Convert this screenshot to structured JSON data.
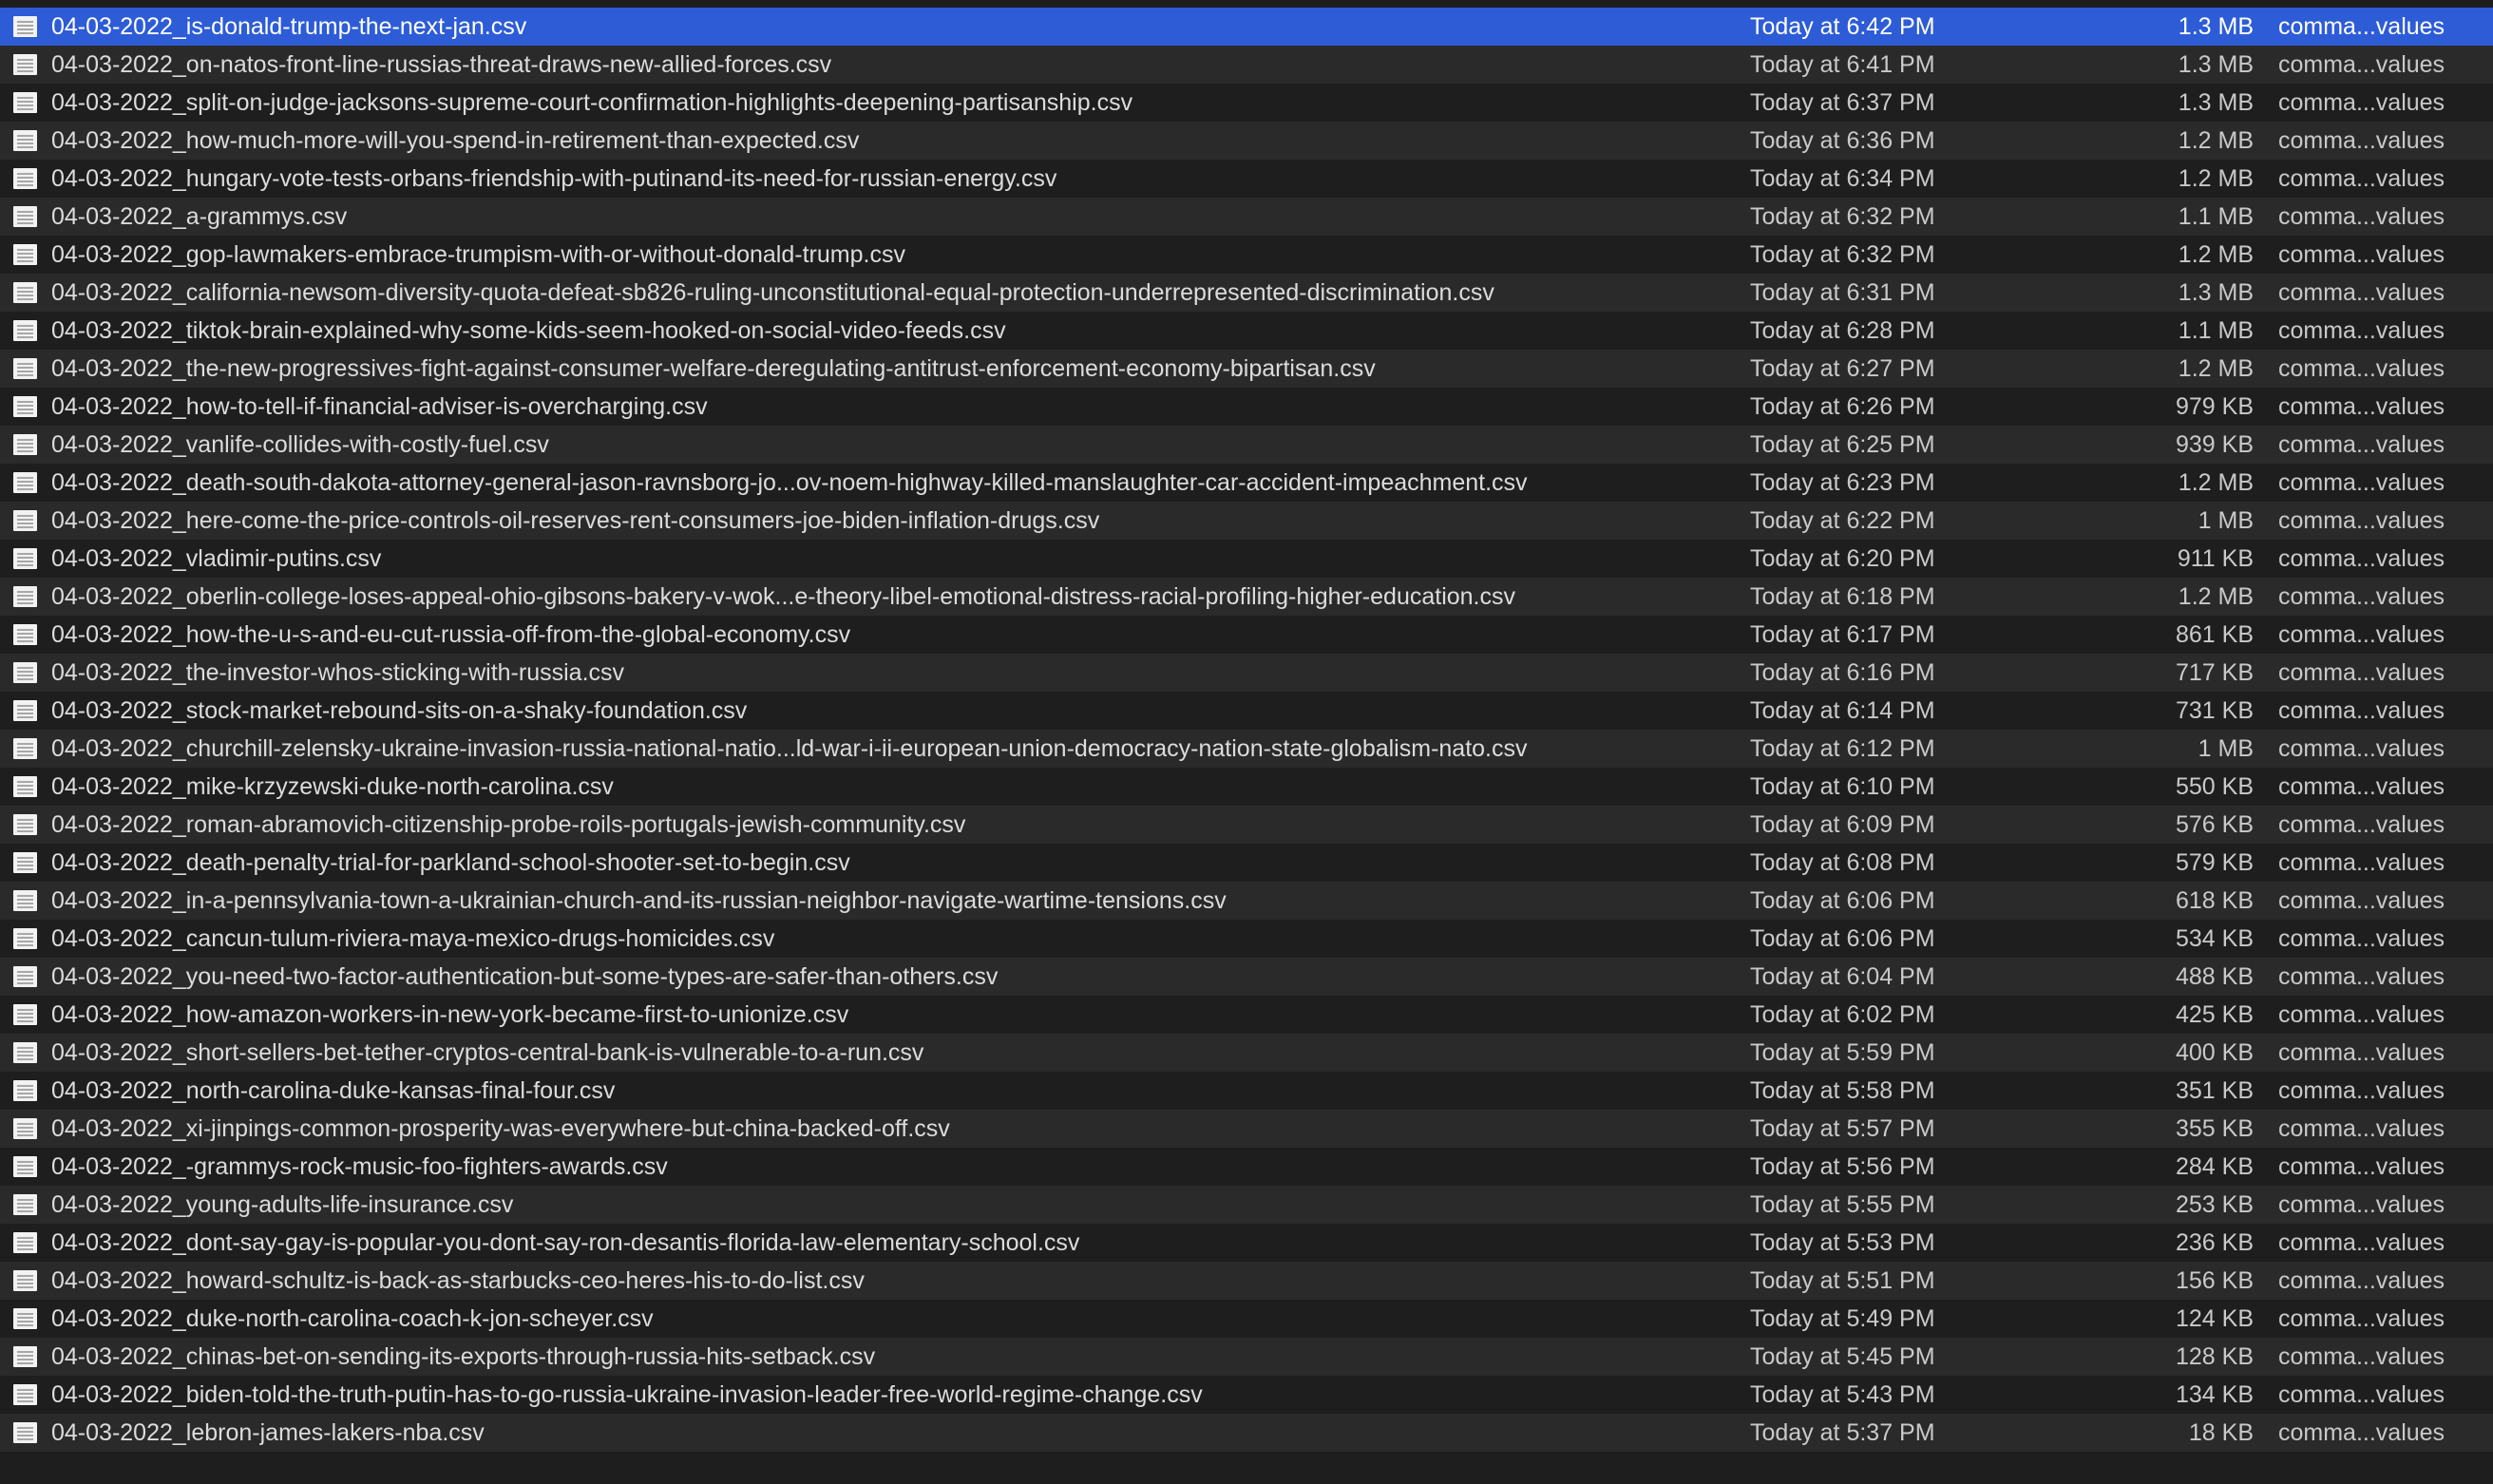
{
  "files": [
    {
      "name": "04-03-2022_is-donald-trump-the-next-jan.csv",
      "date": "Today at 6:42 PM",
      "size": "1.3 MB",
      "kind": "comma...values",
      "selected": true
    },
    {
      "name": "04-03-2022_on-natos-front-line-russias-threat-draws-new-allied-forces.csv",
      "date": "Today at 6:41 PM",
      "size": "1.3 MB",
      "kind": "comma...values"
    },
    {
      "name": "04-03-2022_split-on-judge-jacksons-supreme-court-confirmation-highlights-deepening-partisanship.csv",
      "date": "Today at 6:37 PM",
      "size": "1.3 MB",
      "kind": "comma...values"
    },
    {
      "name": "04-03-2022_how-much-more-will-you-spend-in-retirement-than-expected.csv",
      "date": "Today at 6:36 PM",
      "size": "1.2 MB",
      "kind": "comma...values"
    },
    {
      "name": "04-03-2022_hungary-vote-tests-orbans-friendship-with-putinand-its-need-for-russian-energy.csv",
      "date": "Today at 6:34 PM",
      "size": "1.2 MB",
      "kind": "comma...values"
    },
    {
      "name": "04-03-2022_a-grammys.csv",
      "date": "Today at 6:32 PM",
      "size": "1.1 MB",
      "kind": "comma...values"
    },
    {
      "name": "04-03-2022_gop-lawmakers-embrace-trumpism-with-or-without-donald-trump.csv",
      "date": "Today at 6:32 PM",
      "size": "1.2 MB",
      "kind": "comma...values"
    },
    {
      "name": "04-03-2022_california-newsom-diversity-quota-defeat-sb826-ruling-unconstitutional-equal-protection-underrepresented-discrimination.csv",
      "date": "Today at 6:31 PM",
      "size": "1.3 MB",
      "kind": "comma...values"
    },
    {
      "name": "04-03-2022_tiktok-brain-explained-why-some-kids-seem-hooked-on-social-video-feeds.csv",
      "date": "Today at 6:28 PM",
      "size": "1.1 MB",
      "kind": "comma...values"
    },
    {
      "name": "04-03-2022_the-new-progressives-fight-against-consumer-welfare-deregulating-antitrust-enforcement-economy-bipartisan.csv",
      "date": "Today at 6:27 PM",
      "size": "1.2 MB",
      "kind": "comma...values"
    },
    {
      "name": "04-03-2022_how-to-tell-if-financial-adviser-is-overcharging.csv",
      "date": "Today at 6:26 PM",
      "size": "979 KB",
      "kind": "comma...values"
    },
    {
      "name": "04-03-2022_vanlife-collides-with-costly-fuel.csv",
      "date": "Today at 6:25 PM",
      "size": "939 KB",
      "kind": "comma...values"
    },
    {
      "name": "04-03-2022_death-south-dakota-attorney-general-jason-ravnsborg-jo...ov-noem-highway-killed-manslaughter-car-accident-impeachment.csv",
      "date": "Today at 6:23 PM",
      "size": "1.2 MB",
      "kind": "comma...values"
    },
    {
      "name": "04-03-2022_here-come-the-price-controls-oil-reserves-rent-consumers-joe-biden-inflation-drugs.csv",
      "date": "Today at 6:22 PM",
      "size": "1 MB",
      "kind": "comma...values"
    },
    {
      "name": "04-03-2022_vladimir-putins.csv",
      "date": "Today at 6:20 PM",
      "size": "911 KB",
      "kind": "comma...values"
    },
    {
      "name": "04-03-2022_oberlin-college-loses-appeal-ohio-gibsons-bakery-v-wok...e-theory-libel-emotional-distress-racial-profiling-higher-education.csv",
      "date": "Today at 6:18 PM",
      "size": "1.2 MB",
      "kind": "comma...values"
    },
    {
      "name": "04-03-2022_how-the-u-s-and-eu-cut-russia-off-from-the-global-economy.csv",
      "date": "Today at 6:17 PM",
      "size": "861 KB",
      "kind": "comma...values"
    },
    {
      "name": "04-03-2022_the-investor-whos-sticking-with-russia.csv",
      "date": "Today at 6:16 PM",
      "size": "717 KB",
      "kind": "comma...values"
    },
    {
      "name": "04-03-2022_stock-market-rebound-sits-on-a-shaky-foundation.csv",
      "date": "Today at 6:14 PM",
      "size": "731 KB",
      "kind": "comma...values"
    },
    {
      "name": "04-03-2022_churchill-zelensky-ukraine-invasion-russia-national-natio...ld-war-i-ii-european-union-democracy-nation-state-globalism-nato.csv",
      "date": "Today at 6:12 PM",
      "size": "1 MB",
      "kind": "comma...values"
    },
    {
      "name": "04-03-2022_mike-krzyzewski-duke-north-carolina.csv",
      "date": "Today at 6:10 PM",
      "size": "550 KB",
      "kind": "comma...values"
    },
    {
      "name": "04-03-2022_roman-abramovich-citizenship-probe-roils-portugals-jewish-community.csv",
      "date": "Today at 6:09 PM",
      "size": "576 KB",
      "kind": "comma...values"
    },
    {
      "name": "04-03-2022_death-penalty-trial-for-parkland-school-shooter-set-to-begin.csv",
      "date": "Today at 6:08 PM",
      "size": "579 KB",
      "kind": "comma...values"
    },
    {
      "name": "04-03-2022_in-a-pennsylvania-town-a-ukrainian-church-and-its-russian-neighbor-navigate-wartime-tensions.csv",
      "date": "Today at 6:06 PM",
      "size": "618 KB",
      "kind": "comma...values"
    },
    {
      "name": "04-03-2022_cancun-tulum-riviera-maya-mexico-drugs-homicides.csv",
      "date": "Today at 6:06 PM",
      "size": "534 KB",
      "kind": "comma...values"
    },
    {
      "name": "04-03-2022_you-need-two-factor-authentication-but-some-types-are-safer-than-others.csv",
      "date": "Today at 6:04 PM",
      "size": "488 KB",
      "kind": "comma...values"
    },
    {
      "name": "04-03-2022_how-amazon-workers-in-new-york-became-first-to-unionize.csv",
      "date": "Today at 6:02 PM",
      "size": "425 KB",
      "kind": "comma...values"
    },
    {
      "name": "04-03-2022_short-sellers-bet-tether-cryptos-central-bank-is-vulnerable-to-a-run.csv",
      "date": "Today at 5:59 PM",
      "size": "400 KB",
      "kind": "comma...values"
    },
    {
      "name": "04-03-2022_north-carolina-duke-kansas-final-four.csv",
      "date": "Today at 5:58 PM",
      "size": "351 KB",
      "kind": "comma...values"
    },
    {
      "name": "04-03-2022_xi-jinpings-common-prosperity-was-everywhere-but-china-backed-off.csv",
      "date": "Today at 5:57 PM",
      "size": "355 KB",
      "kind": "comma...values"
    },
    {
      "name": "04-03-2022_-grammys-rock-music-foo-fighters-awards.csv",
      "date": "Today at 5:56 PM",
      "size": "284 KB",
      "kind": "comma...values"
    },
    {
      "name": "04-03-2022_young-adults-life-insurance.csv",
      "date": "Today at 5:55 PM",
      "size": "253 KB",
      "kind": "comma...values"
    },
    {
      "name": "04-03-2022_dont-say-gay-is-popular-you-dont-say-ron-desantis-florida-law-elementary-school.csv",
      "date": "Today at 5:53 PM",
      "size": "236 KB",
      "kind": "comma...values"
    },
    {
      "name": "04-03-2022_howard-schultz-is-back-as-starbucks-ceo-heres-his-to-do-list.csv",
      "date": "Today at 5:51 PM",
      "size": "156 KB",
      "kind": "comma...values"
    },
    {
      "name": "04-03-2022_duke-north-carolina-coach-k-jon-scheyer.csv",
      "date": "Today at 5:49 PM",
      "size": "124 KB",
      "kind": "comma...values"
    },
    {
      "name": "04-03-2022_chinas-bet-on-sending-its-exports-through-russia-hits-setback.csv",
      "date": "Today at 5:45 PM",
      "size": "128 KB",
      "kind": "comma...values"
    },
    {
      "name": "04-03-2022_biden-told-the-truth-putin-has-to-go-russia-ukraine-invasion-leader-free-world-regime-change.csv",
      "date": "Today at 5:43 PM",
      "size": "134 KB",
      "kind": "comma...values"
    },
    {
      "name": "04-03-2022_lebron-james-lakers-nba.csv",
      "date": "Today at 5:37 PM",
      "size": "18 KB",
      "kind": "comma...values"
    }
  ]
}
